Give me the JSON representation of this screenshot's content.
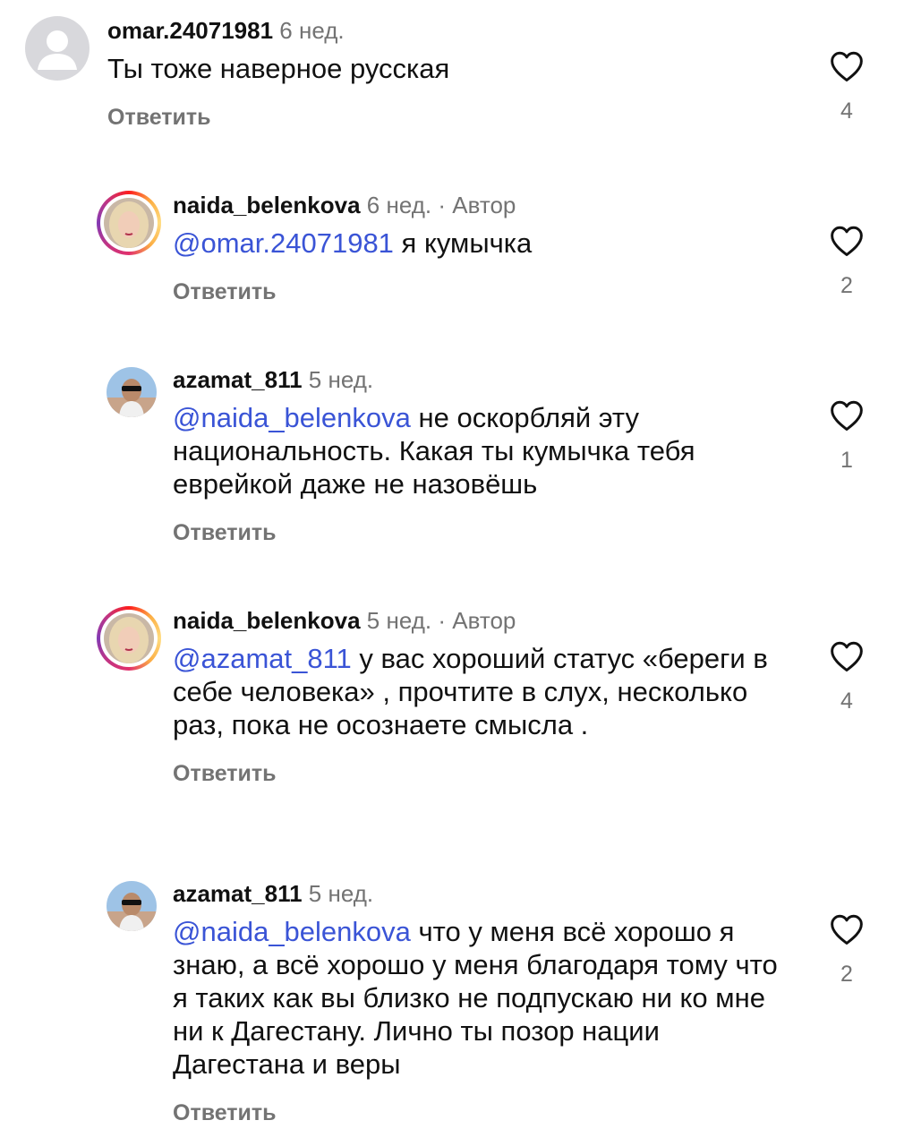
{
  "reply_label": "Ответить",
  "colors": {
    "mention": "#3a54d6",
    "secondary": "#737373",
    "accent_ring": "#e1306c"
  },
  "comments": [
    {
      "username": "omar.24071981",
      "time": "6 нед.",
      "author": "",
      "mention": "",
      "text": "Ты тоже наверное русская",
      "likes": "4",
      "avatar": "default-avatar"
    },
    {
      "username": "naida_belenkova",
      "time": "6 нед.",
      "author": "Автор",
      "mention": "@omar.24071981",
      "text": " я кумычка",
      "likes": "2",
      "avatar": "story-ring-avatar"
    },
    {
      "username": "azamat_811",
      "time": "5 нед.",
      "author": "",
      "mention": "@naida_belenkova",
      "text": " не оскорбляй эту национальность. Какая ты кумычка тебя еврейкой даже не назовёшь",
      "likes": "1",
      "avatar": "photo-avatar"
    },
    {
      "username": "naida_belenkova",
      "time": "5 нед.",
      "author": "Автор",
      "mention": "@azamat_811",
      "text": " у вас хороший статус «береги в себе человека» , прочтите в слух, несколько раз, пока не осознаете смысла .",
      "likes": "4",
      "avatar": "story-ring-avatar"
    },
    {
      "username": "azamat_811",
      "time": "5 нед.",
      "author": "",
      "mention": "@naida_belenkova",
      "text": " что у меня всё хорошо я знаю, а всё хорошо у меня благодаря тому что я таких как вы близко не подпускаю ни ко мне ни к Дагестану. Лично ты позор нации Дагестана и веры",
      "likes": "2",
      "avatar": "photo-avatar"
    }
  ]
}
